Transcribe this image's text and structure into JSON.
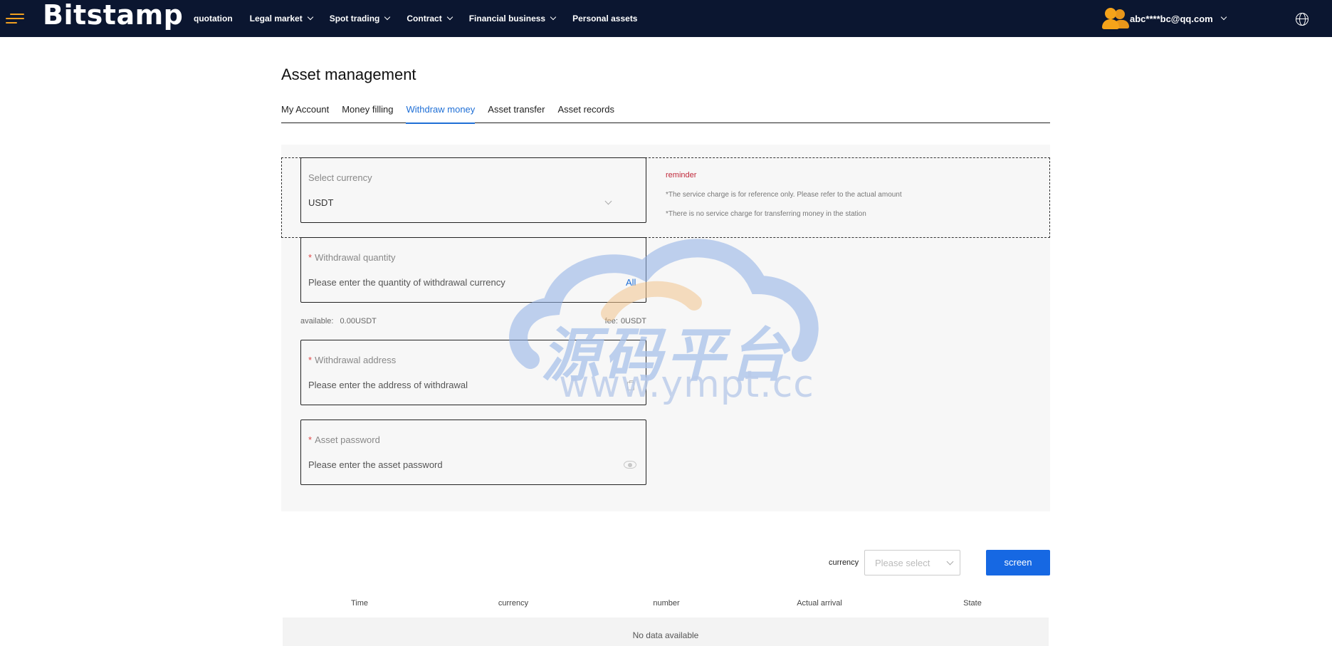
{
  "navbar": {
    "logo": "Bitstamp",
    "links": [
      {
        "label": "quotation",
        "dropdown": false
      },
      {
        "label": "Legal market",
        "dropdown": true
      },
      {
        "label": "Spot trading",
        "dropdown": true
      },
      {
        "label": "Contract",
        "dropdown": true
      },
      {
        "label": "Financial business",
        "dropdown": true
      },
      {
        "label": "Personal assets",
        "dropdown": false
      }
    ],
    "user_email": "abc****bc@qq.com"
  },
  "page": {
    "title": "Asset management",
    "tabs": [
      "My Account",
      "Money filling",
      "Withdraw money",
      "Asset transfer",
      "Asset records"
    ],
    "active_tab": "Withdraw money"
  },
  "form": {
    "currency": {
      "label": "Select currency",
      "value": "USDT"
    },
    "quantity": {
      "required_mark": "*",
      "label": "Withdrawal quantity",
      "placeholder": "Please enter the quantity of withdrawal currency",
      "all_label": "All"
    },
    "available_label": "available:",
    "available_value": "0.00USDT",
    "fee_label": "fee:",
    "fee_value": "0USDT",
    "address": {
      "required_mark": "*",
      "label": "Withdrawal address",
      "placeholder": "Please enter the address of withdrawal"
    },
    "password": {
      "required_mark": "*",
      "label": "Asset password",
      "placeholder": "Please enter the asset password"
    }
  },
  "reminder": {
    "title": "reminder",
    "notes": [
      "*The service charge is for reference only. Please refer to the actual amount",
      "*There is no service charge for transferring money in the station"
    ]
  },
  "filter": {
    "label": "currency",
    "placeholder": "Please select",
    "button": "screen"
  },
  "table": {
    "headers": [
      "Time",
      "currency",
      "number",
      "Actual arrival",
      "State"
    ],
    "empty_text": "No data available"
  },
  "watermark": {
    "text_cn": "源码平台",
    "text_url": "www.ympt.cc"
  },
  "colors": {
    "navbar_bg": "#0b1630",
    "accent_blue": "#1668e3",
    "reminder_red": "#c0283a",
    "avatar_orange": "#f5a31a"
  }
}
